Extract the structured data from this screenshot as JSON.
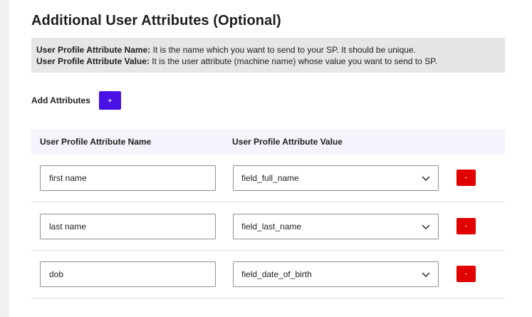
{
  "title": "Additional User Attributes (Optional)",
  "info": {
    "name_label": "User Profile Attribute Name:",
    "name_text": "It is the name which you want to send to your SP. It should be unique.",
    "value_label": "User Profile Attribute Value:",
    "value_text": "It is the user attribute (machine name) whose value you want to send to SP."
  },
  "add": {
    "label": "Add Attributes",
    "button": "+"
  },
  "table": {
    "col_name": "User Profile Attribute Name",
    "col_value": "User Profile Attribute Value",
    "rows": [
      {
        "name": "first name",
        "value": "field_full_name",
        "delete": "-"
      },
      {
        "name": "last name",
        "value": "field_last_name",
        "delete": "-"
      },
      {
        "name": "dob",
        "value": "field_date_of_birth",
        "delete": "-"
      }
    ]
  },
  "colors": {
    "add_button": "#4a11e6",
    "delete_button": "#e30000",
    "info_bg": "#e6e6e6",
    "header_bg": "#f5f3fb"
  },
  "icons": {
    "select_arrow": "chevron-down-icon"
  }
}
